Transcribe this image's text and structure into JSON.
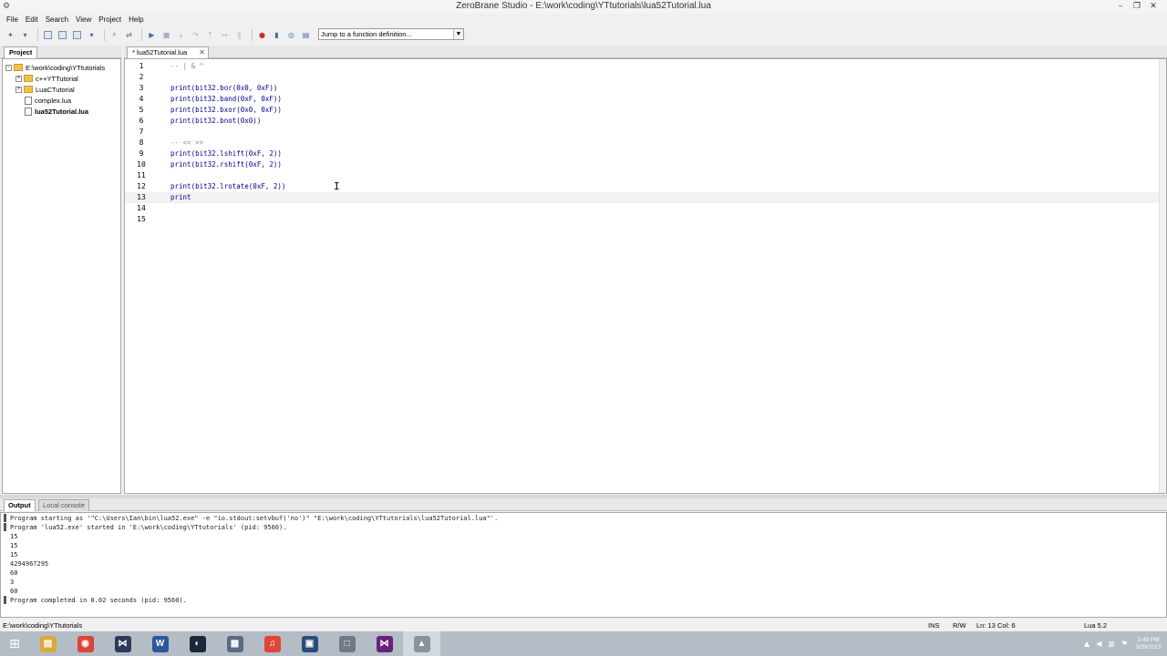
{
  "window": {
    "title": "ZeroBrane Studio - E:\\work\\coding\\YTtutorials\\lua52Tutorial.lua",
    "minimize": "–",
    "restore": "❐",
    "close": "✕"
  },
  "menu": [
    "File",
    "Edit",
    "Search",
    "View",
    "Project",
    "Help"
  ],
  "toolbar": {
    "function_dropdown": "Jump to a function definition...",
    "icons": [
      "new-file-icon",
      "open-file-icon",
      "save-icon",
      "save-all-icon",
      "project-dir-icon",
      "find-icon",
      "replace-icon",
      "run-icon",
      "stop-icon",
      "step-into-icon",
      "step-over-icon",
      "step-out-icon",
      "run-to-cursor-icon",
      "breakpoint-icon",
      "break-icon",
      "watch-icon",
      "stack-icon"
    ]
  },
  "project": {
    "tab_label": "Project",
    "root": "E:\\work\\coding\\YTtutorials",
    "items": [
      {
        "label": "c++YTTutorial",
        "kind": "folder"
      },
      {
        "label": "LuaCTutorial",
        "kind": "folder"
      },
      {
        "label": "complex.lua",
        "kind": "file"
      },
      {
        "label": "lua52Tutorial.lua",
        "kind": "file",
        "selected": true
      }
    ]
  },
  "editor": {
    "tab_label": "* lua52Tutorial.lua",
    "tab_close": "✕",
    "current_line": 13,
    "lines": [
      {
        "n": "1",
        "text": "-- | & ^",
        "comment": true
      },
      {
        "n": "2",
        "text": ""
      },
      {
        "n": "3",
        "text": "print(bit32.bor(0x0, 0xF))"
      },
      {
        "n": "4",
        "text": "print(bit32.band(0xF, 0xF))"
      },
      {
        "n": "5",
        "text": "print(bit32.bxor(0x0, 0xF))"
      },
      {
        "n": "6",
        "text": "print(bit32.bnot(0x0))"
      },
      {
        "n": "7",
        "text": ""
      },
      {
        "n": "8",
        "text": "-- << >>",
        "comment": true
      },
      {
        "n": "9",
        "text": "print(bit32.lshift(0xF, 2))"
      },
      {
        "n": "10",
        "text": "print(bit32.rshift(0xF, 2))"
      },
      {
        "n": "11",
        "text": ""
      },
      {
        "n": "12",
        "text": "print(bit32.lrotate(0xF, 2))"
      },
      {
        "n": "13",
        "text": "print"
      },
      {
        "n": "14",
        "text": ""
      },
      {
        "n": "15",
        "text": ""
      }
    ]
  },
  "output": {
    "tabs": [
      "Output",
      "Local console"
    ],
    "lines": [
      {
        "text": "Program starting as '\"C:\\Users\\Ian\\bin\\lua52.exe\" -e \"io.stdout:setvbuf('no')\" \"E:\\work\\coding\\YTtutorials\\lua52Tutorial.lua\"'.",
        "marker": true
      },
      {
        "text": "Program 'lua52.exe' started in 'E:\\work\\coding\\YTtutorials' (pid: 9560).",
        "marker": true
      },
      {
        "text": "15"
      },
      {
        "text": "15"
      },
      {
        "text": "15"
      },
      {
        "text": "4294967295"
      },
      {
        "text": "60"
      },
      {
        "text": "3"
      },
      {
        "text": "60"
      },
      {
        "text": "Program completed in 0.02 seconds (pid: 9560).",
        "marker": true
      }
    ]
  },
  "status": {
    "path": "E:\\work\\coding\\YTtutorials",
    "mode": "INS",
    "access": "R/W",
    "position": "Ln: 13 Col: 6",
    "interpreter": "Lua 5.2"
  },
  "taskbar": {
    "apps": [
      {
        "name": "file-explorer-icon",
        "glyph": "▤",
        "color": "#d9a93c"
      },
      {
        "name": "chrome-icon",
        "glyph": "◉",
        "color": "#db4437"
      },
      {
        "name": "visual-studio-icon",
        "glyph": "⋈",
        "color": "#2d3a5c"
      },
      {
        "name": "word-icon",
        "glyph": "W",
        "color": "#2b579a"
      },
      {
        "name": "steam-icon",
        "glyph": "◐",
        "color": "#1b2838"
      },
      {
        "name": "calculator-icon",
        "glyph": "▦",
        "color": "#5a6a80"
      },
      {
        "name": "itunes-icon",
        "glyph": "♫",
        "color": "#e0453a"
      },
      {
        "name": "remote-desktop-icon",
        "glyph": "▣",
        "color": "#2a4d7a"
      },
      {
        "name": "blank-window-icon",
        "glyph": "□",
        "color": "#707a86"
      },
      {
        "name": "visual-studio-purple-icon",
        "glyph": "⋈",
        "color": "#68217a"
      },
      {
        "name": "zerobrane-icon",
        "glyph": "▲",
        "color": "#8a929c"
      }
    ],
    "clock_time": "3:49 PM",
    "clock_date": "3/29/2015"
  }
}
